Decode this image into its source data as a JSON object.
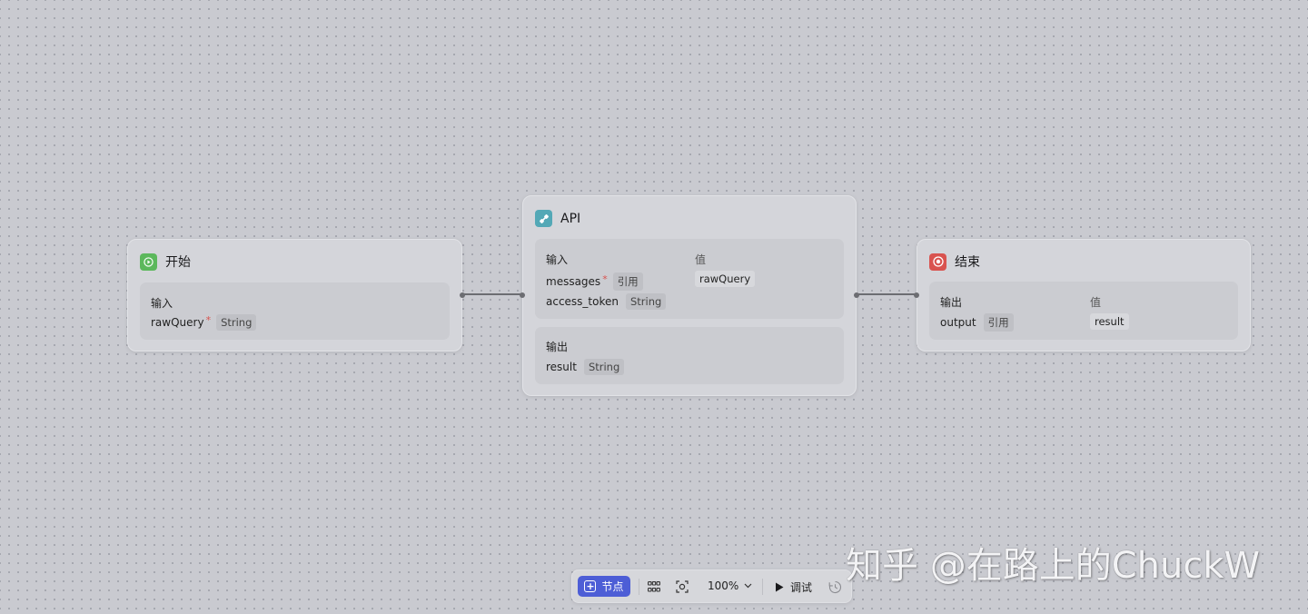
{
  "nodes": {
    "start": {
      "title": "开始",
      "icon": "play-icon",
      "icon_color": "#5cb85c",
      "input_label": "输入",
      "inputs": [
        {
          "name": "rawQuery",
          "required": true,
          "type": "String"
        }
      ]
    },
    "api": {
      "title": "API",
      "icon": "link-icon",
      "icon_color": "#53a8b6",
      "input_label": "输入",
      "value_label": "值",
      "inputs": [
        {
          "name": "messages",
          "required": true,
          "type": "引用",
          "value": "rawQuery"
        },
        {
          "name": "access_token",
          "required": false,
          "type": "String",
          "value": ""
        }
      ],
      "output_label": "输出",
      "outputs": [
        {
          "name": "result",
          "type": "String"
        }
      ]
    },
    "end": {
      "title": "结束",
      "icon": "stop-icon",
      "icon_color": "#d9534f",
      "output_label": "输出",
      "value_label": "值",
      "outputs": [
        {
          "name": "output",
          "type": "引用",
          "value": "result"
        }
      ]
    }
  },
  "toolbar": {
    "add_node_label": "节点",
    "zoom": "100%",
    "debug_label": "调试",
    "accent": "#4d5ed6"
  },
  "watermark": "知乎 @在路上的ChuckW"
}
